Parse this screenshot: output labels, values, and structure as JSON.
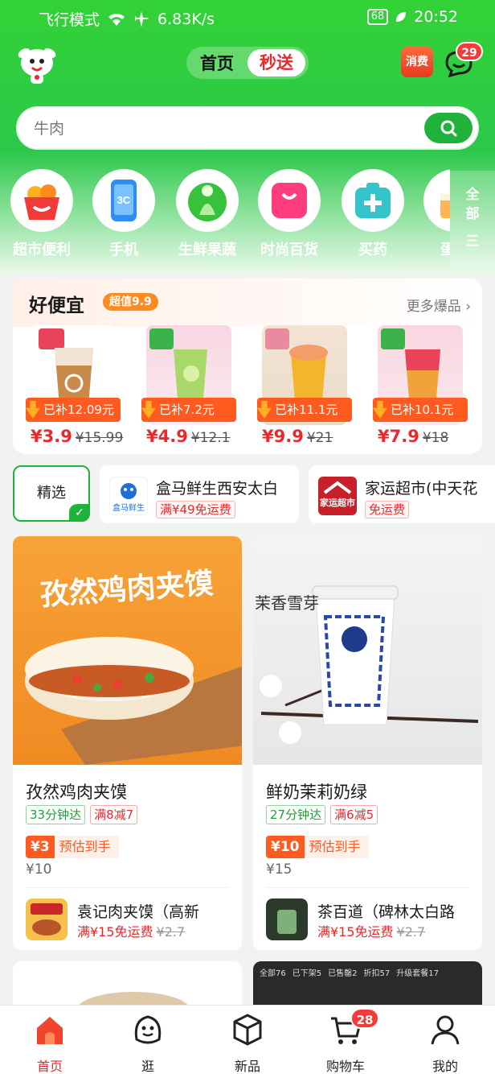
{
  "status_bar": {
    "left": "飞行模式",
    "speed": "6.83K/s",
    "battery": "68",
    "time": "20:52"
  },
  "header": {
    "tab_home": "首页",
    "tab_seckill": "秒送",
    "consume_label": "消费",
    "message_badge": "29",
    "accent": "#2fcf3a"
  },
  "search": {
    "placeholder": "牛肉"
  },
  "categories": [
    {
      "label": "超市便利",
      "icon": "basket-icon"
    },
    {
      "label": "手机",
      "icon": "phone-icon"
    },
    {
      "label": "生鲜果蔬",
      "icon": "vegetable-icon"
    },
    {
      "label": "时尚百货",
      "icon": "shopping-bag-icon"
    },
    {
      "label": "买药",
      "icon": "medicine-box-icon"
    },
    {
      "label": "蛋糕",
      "icon": "cake-icon"
    }
  ],
  "all_categories": {
    "line1": "全",
    "line2": "部",
    "line3": "三"
  },
  "deals": {
    "title": "好便宜",
    "tag": "超值9.9",
    "more": "更多爆品 ›",
    "items": [
      {
        "subsidy": "已补12.09元",
        "price": "¥3.9",
        "old_price": "¥15.99"
      },
      {
        "subsidy": "已补7.2元",
        "price": "¥4.9",
        "old_price": "¥12.1"
      },
      {
        "subsidy": "已补11.1元",
        "price": "¥9.9",
        "old_price": "¥21"
      },
      {
        "subsidy": "已补10.1元",
        "price": "¥7.9",
        "old_price": "¥18"
      }
    ]
  },
  "store_tabs": {
    "selected": "精选",
    "stores": [
      {
        "name": "盒马鲜生西安太白",
        "fee": "满¥49免运费",
        "logo_text": "盒马鲜生"
      },
      {
        "name": "家运超市(中天花",
        "fee": "免运费",
        "logo_text": "家运超市"
      }
    ]
  },
  "cards": [
    {
      "image_text": "孜然鸡肉夹馍",
      "title": "孜然鸡肉夹馍",
      "eta": "33分钟达",
      "promo": "满8减7",
      "coupon": "¥3",
      "estimate": "预估到手",
      "orig_price": "¥10",
      "store_name": "袁记肉夹馍（高新",
      "store_fee": "满¥15免运费",
      "store_fee_old": "¥2.7"
    },
    {
      "image_text": "茉香雪芽",
      "title": "鲜奶茉莉奶绿",
      "eta": "27分钟达",
      "promo": "满6减5",
      "coupon": "¥10",
      "estimate": "预估到手",
      "orig_price": "¥15",
      "store_name": "茶百道（碑林太白路",
      "store_fee": "满¥15免运费",
      "store_fee_old": "¥2.7"
    }
  ],
  "partial_card_tabs": [
    "全部76",
    "已下架5",
    "已售罄2",
    "折扣57",
    "升级套餐17"
  ],
  "bottom_nav": [
    {
      "label": "首页",
      "icon": "home-icon"
    },
    {
      "label": "逛",
      "icon": "browse-icon"
    },
    {
      "label": "新品",
      "icon": "new-product-icon"
    },
    {
      "label": "购物车",
      "icon": "cart-icon",
      "badge": "28"
    },
    {
      "label": "我的",
      "icon": "profile-icon"
    }
  ]
}
